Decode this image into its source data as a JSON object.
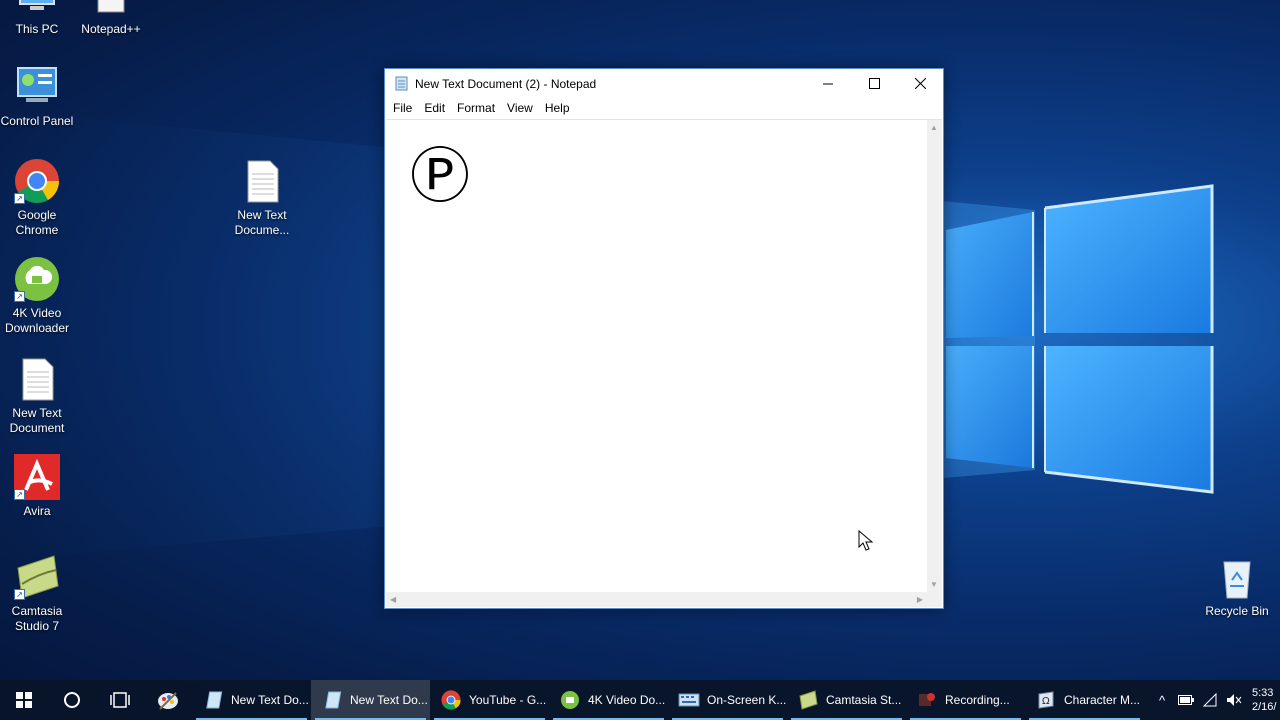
{
  "desktop": {
    "icons": [
      {
        "label": "This PC"
      },
      {
        "label": "Notepad++"
      },
      {
        "label": "Control Panel"
      },
      {
        "label": "Google Chrome"
      },
      {
        "label": "New Text Docume..."
      },
      {
        "label": "4K Video Downloader"
      },
      {
        "label": "New Text Document"
      },
      {
        "label": "Avira"
      },
      {
        "label": "Camtasia Studio 7"
      },
      {
        "label": "Recycle Bin"
      }
    ]
  },
  "notepad": {
    "title": "New Text Document (2) - Notepad",
    "menu": [
      "File",
      "Edit",
      "Format",
      "View",
      "Help"
    ],
    "content": "Ⓟ"
  },
  "taskbar": {
    "items": [
      {
        "label": "New Text Do...",
        "icon": "notepad-icon"
      },
      {
        "label": "New Text Do...",
        "icon": "notepad-icon"
      },
      {
        "label": "YouTube - G...",
        "icon": "chrome-icon"
      },
      {
        "label": "4K Video Do...",
        "icon": "4k-video-icon"
      },
      {
        "label": "On-Screen K...",
        "icon": "keyboard-icon"
      },
      {
        "label": "Camtasia St...",
        "icon": "camtasia-icon"
      },
      {
        "label": "Recording...",
        "icon": "recording-icon"
      },
      {
        "label": "Character M...",
        "icon": "character-map-icon"
      }
    ],
    "clock_time": "5:33",
    "clock_date": "2/16/"
  },
  "colors": {
    "accent": "#76b9ed",
    "taskbar": "#091428",
    "desktop_dark": "#061d4a",
    "logo_light": "#4fb0ff"
  }
}
